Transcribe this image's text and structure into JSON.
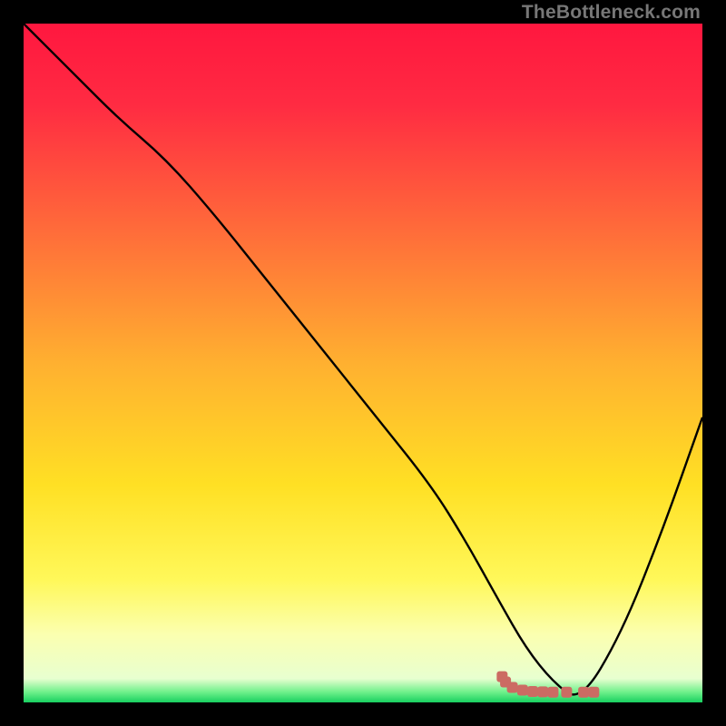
{
  "watermark": "TheBottleneck.com",
  "chart_data": {
    "type": "line",
    "title": "",
    "xlabel": "",
    "ylabel": "",
    "xlim": [
      0,
      100
    ],
    "ylim": [
      0,
      100
    ],
    "grid": false,
    "background_gradient": {
      "type": "vertical",
      "stops": [
        {
          "pos": 0.0,
          "color": "#ff173f"
        },
        {
          "pos": 0.12,
          "color": "#ff2b42"
        },
        {
          "pos": 0.3,
          "color": "#ff6a3a"
        },
        {
          "pos": 0.5,
          "color": "#ffb030"
        },
        {
          "pos": 0.68,
          "color": "#ffe024"
        },
        {
          "pos": 0.82,
          "color": "#fff85a"
        },
        {
          "pos": 0.9,
          "color": "#fbffb0"
        },
        {
          "pos": 0.965,
          "color": "#e8ffd0"
        },
        {
          "pos": 0.985,
          "color": "#6df08a"
        },
        {
          "pos": 1.0,
          "color": "#18d060"
        }
      ]
    },
    "series": [
      {
        "name": "bottleneck-curve",
        "stroke": "#000000",
        "x": [
          0,
          8,
          14,
          21,
          28,
          36,
          44,
          52,
          60,
          65,
          70,
          74,
          78,
          82,
          88,
          94,
          100
        ],
        "values": [
          100,
          92,
          86,
          80,
          72,
          62,
          52,
          42,
          32,
          24,
          15,
          8,
          3,
          0,
          10,
          25,
          42
        ]
      }
    ],
    "markers": {
      "name": "bottleneck-band",
      "color": "#cc6b63",
      "points": [
        {
          "x": 70.5,
          "y": 3.8
        },
        {
          "x": 71.0,
          "y": 3.0
        },
        {
          "x": 72.0,
          "y": 2.2
        },
        {
          "x": 73.5,
          "y": 1.8
        },
        {
          "x": 75.0,
          "y": 1.6
        },
        {
          "x": 76.5,
          "y": 1.55
        },
        {
          "x": 78.0,
          "y": 1.5
        },
        {
          "x": 80.0,
          "y": 1.5
        },
        {
          "x": 82.5,
          "y": 1.5
        },
        {
          "x": 84.0,
          "y": 1.5
        }
      ]
    }
  }
}
